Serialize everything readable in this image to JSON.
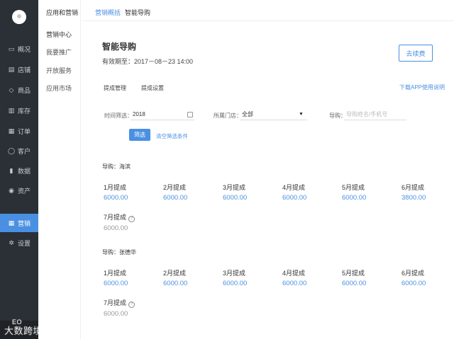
{
  "nav": {
    "items": [
      {
        "label": "概况",
        "icon": "monitor-icon"
      },
      {
        "label": "店铺",
        "icon": "store-icon"
      },
      {
        "label": "商品",
        "icon": "tag-icon"
      },
      {
        "label": "库存",
        "icon": "warehouse-icon"
      },
      {
        "label": "订单",
        "icon": "order-icon"
      },
      {
        "label": "客户",
        "icon": "user-icon"
      },
      {
        "label": "数据",
        "icon": "bar-chart-icon"
      },
      {
        "label": "资产",
        "icon": "coin-icon"
      },
      {
        "label": "营销",
        "icon": "grid-icon",
        "active": true
      },
      {
        "label": "设置",
        "icon": "gear-icon"
      }
    ],
    "watermark": "大数跨境",
    "watermark_small": "EO"
  },
  "subnav": {
    "header": "应用和营销",
    "items": [
      "营销中心",
      "我要推广",
      "开放服务",
      "应用市场"
    ]
  },
  "breadcrumb": {
    "parent": "营销概括",
    "current": "智能导购"
  },
  "page": {
    "title": "智能导购",
    "expire": "有效期至：2017－08－23 14:00",
    "renew_label": "去续费",
    "tabs": [
      "提成管理",
      "提成设置"
    ],
    "links": [
      "下载APP",
      "使用说明"
    ]
  },
  "filters": {
    "time_label": "时间筛选：",
    "time_value": "2018",
    "store_label": "所属门店：",
    "store_value": "全部",
    "guide_label": "导购：",
    "guide_placeholder": "导购姓名/手机号",
    "filter_button": "筛选",
    "clear_link": "清空筛选条件"
  },
  "groups": [
    {
      "guide": "导购：海滨",
      "months": [
        {
          "label": "1月提成",
          "value": "6000.00"
        },
        {
          "label": "2月提成",
          "value": "6000.00"
        },
        {
          "label": "3月提成",
          "value": "6000.00"
        },
        {
          "label": "4月提成",
          "value": "6000.00"
        },
        {
          "label": "5月提成",
          "value": "6000.00"
        },
        {
          "label": "6月提成",
          "value": "3800.00"
        },
        {
          "label": "7月提成",
          "value": "6000.00",
          "pending": true
        }
      ]
    },
    {
      "guide": "导购：张德华",
      "months": [
        {
          "label": "1月提成",
          "value": "6000.00"
        },
        {
          "label": "2月提成",
          "value": "6000.00"
        },
        {
          "label": "3月提成",
          "value": "6000.00"
        },
        {
          "label": "4月提成",
          "value": "6000.00"
        },
        {
          "label": "5月提成",
          "value": "6000.00"
        },
        {
          "label": "6月提成",
          "value": "6000.00"
        },
        {
          "label": "7月提成",
          "value": "6000.00",
          "pending": true
        }
      ]
    }
  ],
  "colors": {
    "accent": "#4a90e2",
    "nav_bg": "#2b2f36"
  }
}
